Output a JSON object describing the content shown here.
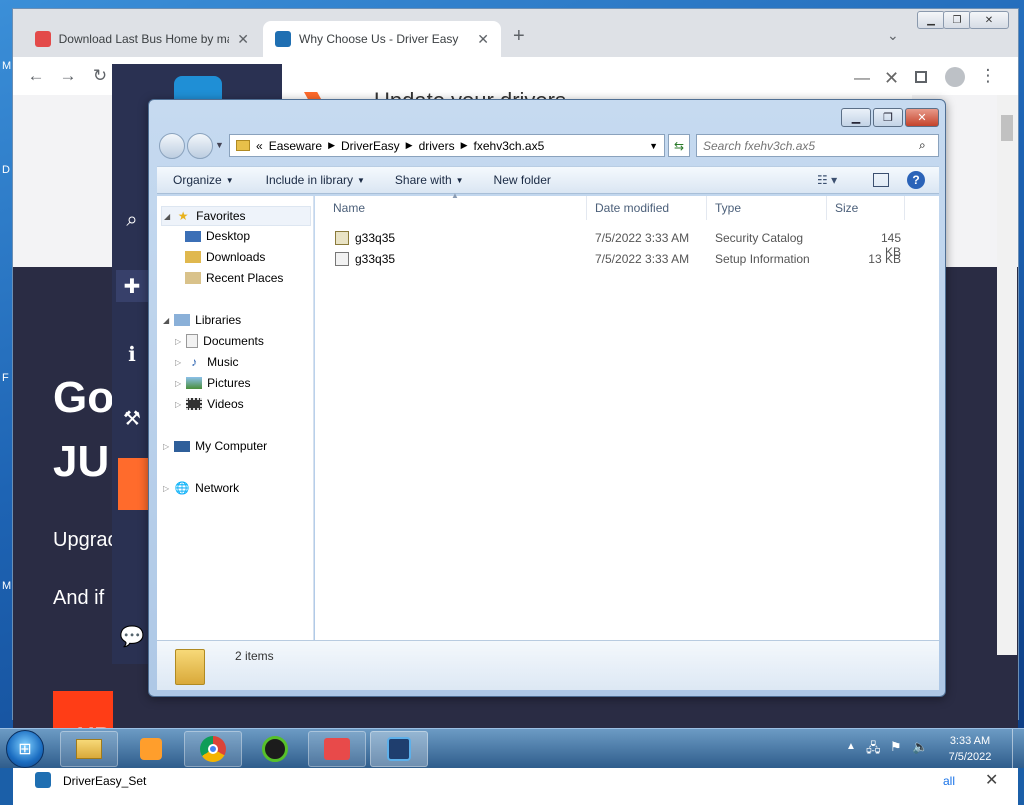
{
  "desktop": {
    "edge_letters": [
      "M",
      "D",
      "F",
      "M"
    ]
  },
  "chrome": {
    "tabs": [
      {
        "title": "Download Last Bus Home by ma",
        "active": false
      },
      {
        "title": "Why Choose Us - Driver Easy",
        "active": true
      }
    ],
    "new_tab": "+",
    "window_controls": {
      "min": "▁",
      "max": "❐",
      "close": "✕"
    },
    "nav": {
      "back": "←",
      "forward": "→",
      "reload": "↻"
    }
  },
  "driver_easy": {
    "header_text": "Update your drivers",
    "hero_line1": "Go",
    "hero_line2": "JU",
    "body_line1": "Upgrac",
    "body_line2": "And if",
    "cta_text": "UP",
    "app_close": "✕",
    "app_min": "—"
  },
  "download_bar": {
    "item": "DriverEasy_Set",
    "show_all": "all",
    "close": "✕"
  },
  "explorer": {
    "breadcrumb": [
      "«",
      "Easeware",
      "DriverEasy",
      "drivers",
      "fxehv3ch.ax5"
    ],
    "search_placeholder": "Search fxehv3ch.ax5",
    "commands": [
      "Organize",
      "Include in library",
      "Share with",
      "New folder"
    ],
    "tree": {
      "favorites": "Favorites",
      "favorites_items": [
        "Desktop",
        "Downloads",
        "Recent Places"
      ],
      "libraries": "Libraries",
      "libraries_items": [
        "Documents",
        "Music",
        "Pictures",
        "Videos"
      ],
      "computer": "My Computer",
      "network": "Network"
    },
    "columns": [
      "Name",
      "Date modified",
      "Type",
      "Size"
    ],
    "files": [
      {
        "name": "g33q35",
        "date": "7/5/2022 3:33 AM",
        "type": "Security Catalog",
        "size": "145 KB"
      },
      {
        "name": "g33q35",
        "date": "7/5/2022 3:33 AM",
        "type": "Setup Information",
        "size": "13 KB"
      }
    ],
    "item_count": "2 items"
  },
  "taskbar": {
    "time": "3:33 AM",
    "date": "7/5/2022"
  },
  "colors": {
    "chrome_tabstrip": "#dee1e6",
    "driver_easy_sidebar": "#2a3152",
    "driver_easy_accent": "#ff6b2c",
    "explorer_frame": "#c6daf0"
  }
}
